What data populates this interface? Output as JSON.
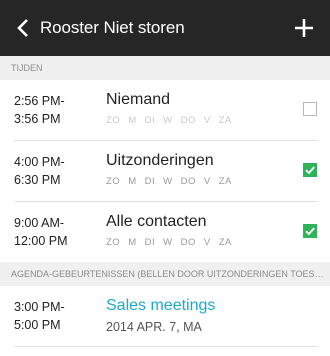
{
  "header": {
    "title": "Rooster Niet storen"
  },
  "sections": {
    "times_header": "TIJDEN",
    "agenda_header": "AGENDA-GEBEURTENISSEN (BELLEN DOOR UITZONDERINGEN TOESTA..."
  },
  "schedules": [
    {
      "start": "2:56 PM-",
      "end": "3:56 PM",
      "label": "Niemand",
      "checked": false
    },
    {
      "start": "4:00 PM-",
      "end": "6:30 PM",
      "label": "Uitzonderingen",
      "checked": true
    },
    {
      "start": "9:00 AM-",
      "end": "12:00 PM",
      "label": "Alle contacten",
      "checked": true
    }
  ],
  "days": [
    "ZO",
    "M",
    "DI",
    "W",
    "DO",
    "V",
    "ZA"
  ],
  "event": {
    "start": "3:00 PM-",
    "end": "5:00 PM",
    "title": "Sales meetings",
    "date": "2014 APR. 7, MA"
  },
  "colors": {
    "topbar": "#262626",
    "accent_green": "#2fb35a",
    "event_blue": "#1aa9cf"
  }
}
